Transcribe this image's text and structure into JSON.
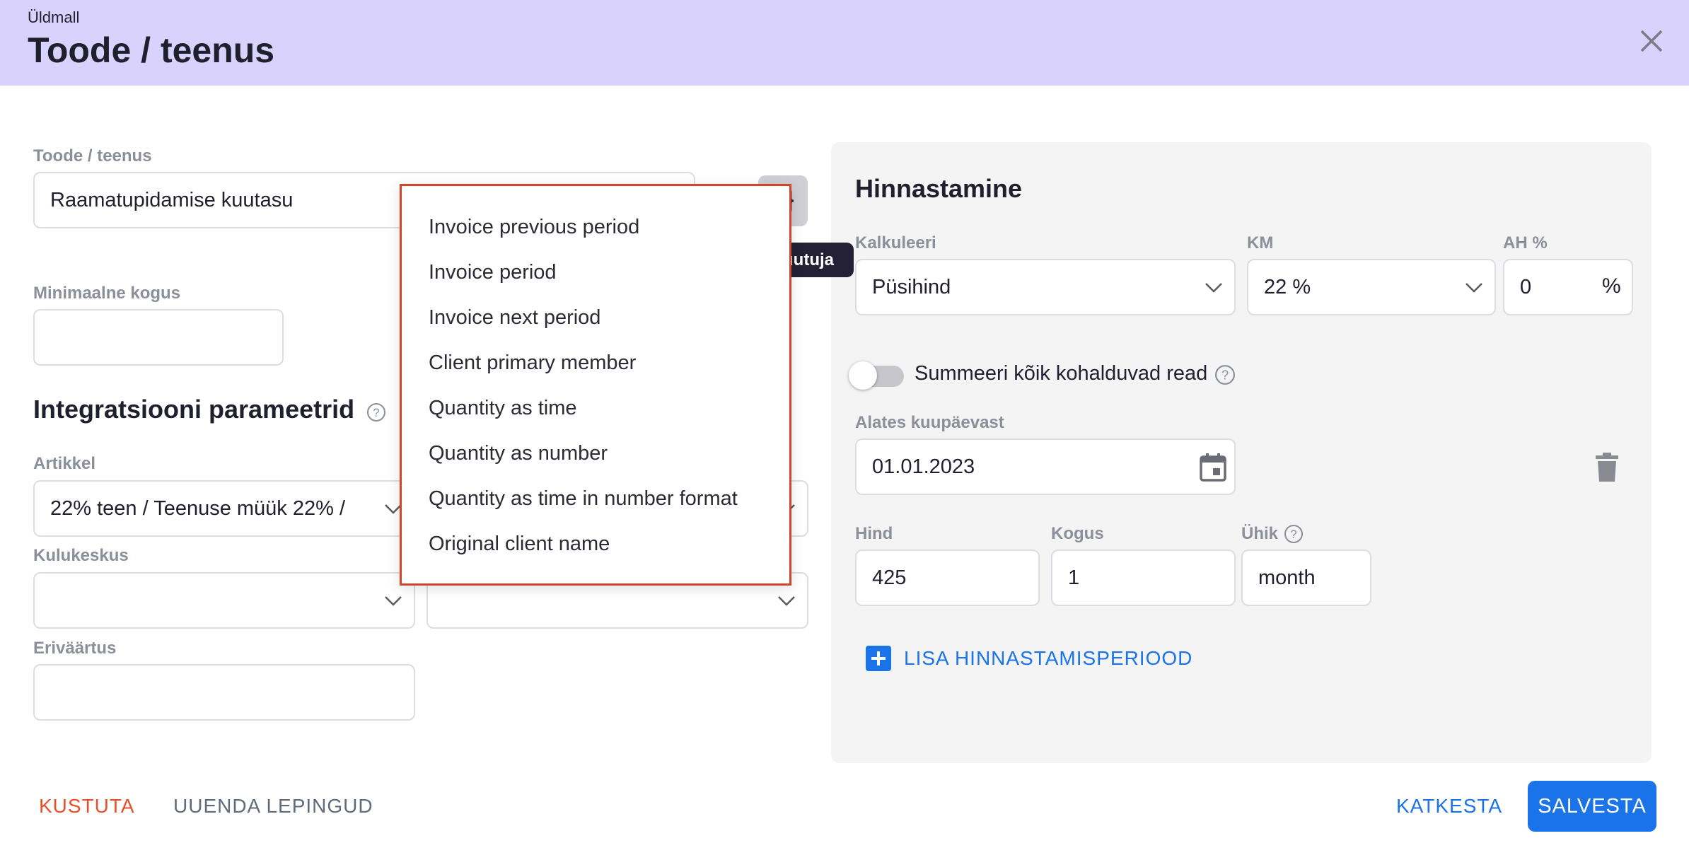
{
  "header": {
    "subtitle": "Üldmall",
    "title": "Toode / teenus"
  },
  "product": {
    "label": "Toode / teenus",
    "value": "Raamatupidamise kuutasu",
    "variable_tooltip": "uutuja"
  },
  "min_quantity": {
    "label": "Minimaalne kogus",
    "value": ""
  },
  "integration": {
    "heading": "Integratsiooni parameetrid",
    "article_label": "Artikkel",
    "article_value": "22% teen / Teenuse müük 22% /",
    "cost_center_label": "Kulukeskus",
    "cost_center_value": "",
    "special_label": "Eriväärtus",
    "special_value": ""
  },
  "variables_menu": {
    "items": [
      "Invoice previous period",
      "Invoice period",
      "Invoice next period",
      "Client primary member",
      "Quantity as time",
      "Quantity as number",
      "Quantity as time in number format",
      "Original client name"
    ]
  },
  "pricing": {
    "heading": "Hinnastamine",
    "calculator_label": "Kalkuleeri",
    "calculator_value": "Püsihind",
    "vat_label": "KM",
    "vat_value": "22 %",
    "discount_label": "AH %",
    "discount_value": "0",
    "discount_unit": "%",
    "sum_toggle_label": "Summeeri kõik kohalduvad read",
    "from_date_label": "Alates kuupäevast",
    "from_date_value": "01.01.2023",
    "price_label": "Hind",
    "price_value": "425",
    "quantity_label": "Kogus",
    "quantity_value": "1",
    "unit_label": "Ühik",
    "unit_value": "month",
    "add_period_label": "LISA HINNASTAMISPERIOOD"
  },
  "footer": {
    "delete_label": "KUSTUTA",
    "renew_label": "UUENDA LEPINGUD",
    "cancel_label": "KATKESTA",
    "save_label": "SALVESTA"
  },
  "colors": {
    "header_bg": "#d8d2fc",
    "primary": "#1a73e8",
    "danger": "#e8502a",
    "panel_bg": "#f4f4f5"
  },
  "icons": [
    "close-icon",
    "chevron-down-icon",
    "calendar-icon",
    "trash-icon",
    "help-icon",
    "plus-icon",
    "variable-braces-icon"
  ]
}
